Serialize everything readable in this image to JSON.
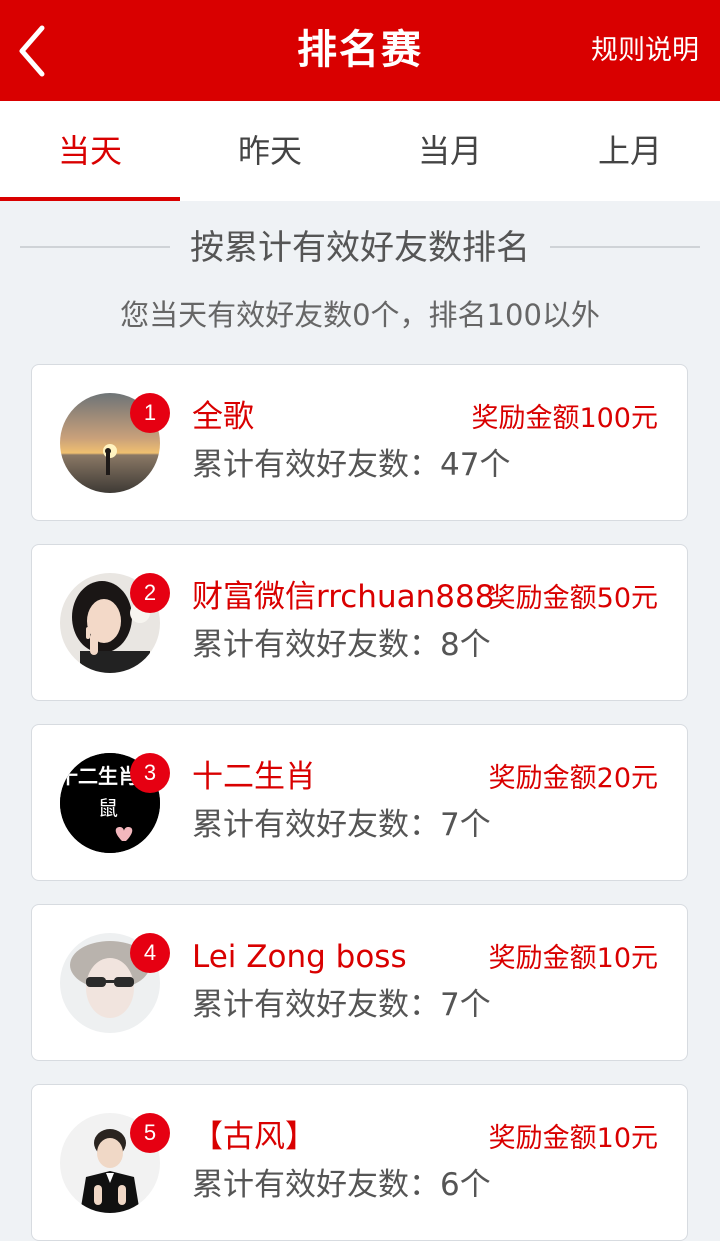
{
  "header": {
    "title": "排名赛",
    "rules_label": "规则说明"
  },
  "tabs": [
    {
      "label": "当天",
      "active": true
    },
    {
      "label": "昨天",
      "active": false
    },
    {
      "label": "当月",
      "active": false
    },
    {
      "label": "上月",
      "active": false
    }
  ],
  "section": {
    "heading": "按累计有效好友数排名",
    "subtitle": "您当天有效好友数0个，排名100以外"
  },
  "ranking": [
    {
      "rank": "1",
      "name": "全歌",
      "reward": "奖励金额100元",
      "count": "累计有效好友数：47个",
      "avatar": "sunset-silhouette"
    },
    {
      "rank": "2",
      "name": "财富微信rrchuan888",
      "reward": "奖励金额50元",
      "count": "累计有效好友数：8个",
      "avatar": "girl-peace-sign"
    },
    {
      "rank": "3",
      "name": "十二生肖",
      "reward": "奖励金额20元",
      "count": "累计有效好友数：7个",
      "avatar": "zodiac-text-logo",
      "avatar_text_top": "十二生肖",
      "avatar_text_mid": "鼠"
    },
    {
      "rank": "4",
      "name": "Lei Zong boss",
      "reward": "奖励金额10元",
      "count": "累计有效好友数：7个",
      "avatar": "sunglasses-portrait"
    },
    {
      "rank": "5",
      "name": "【古风】",
      "reward": "奖励金额10元",
      "count": "累计有效好友数：6个",
      "avatar": "tuxedo-portrait"
    }
  ],
  "colors": {
    "brand_red": "#d90000",
    "badge_red": "#e60012",
    "page_bg": "#eff2f5"
  }
}
